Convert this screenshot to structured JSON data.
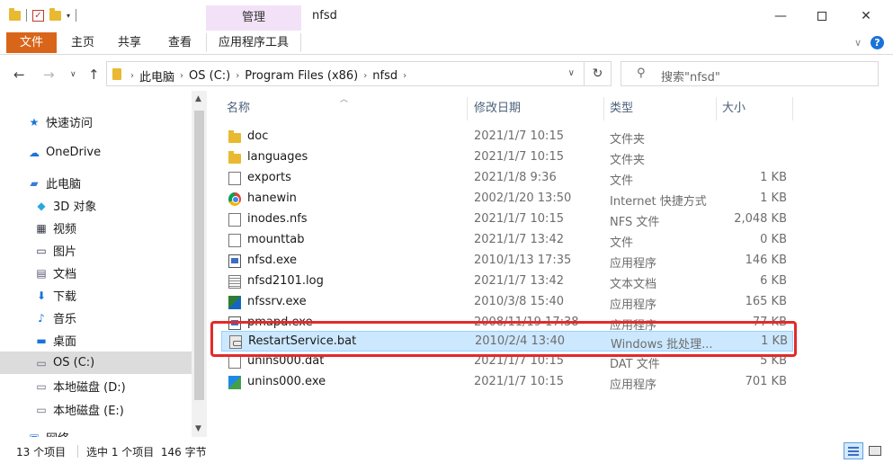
{
  "window": {
    "title": "nfsd",
    "manage_tab": "管理",
    "controls": {
      "minimize": "—",
      "close": "✕"
    }
  },
  "ribbon": {
    "tabs": [
      "文件",
      "主页",
      "共享",
      "查看"
    ],
    "app_tools": "应用程序工具",
    "help": "?"
  },
  "address": {
    "breadcrumbs": [
      "此电脑",
      "OS (C:)",
      "Program Files (x86)",
      "nfsd"
    ],
    "search_placeholder": "搜索\"nfsd\""
  },
  "nav": {
    "items": [
      {
        "label": "快速访问",
        "icon": "star-icon"
      },
      {
        "label": "OneDrive",
        "icon": "cloud-icon"
      },
      {
        "label": "此电脑",
        "icon": "pc-icon"
      },
      {
        "label": "3D 对象",
        "icon": "3d-objects-icon"
      },
      {
        "label": "视频",
        "icon": "video-icon"
      },
      {
        "label": "图片",
        "icon": "pictures-icon"
      },
      {
        "label": "文档",
        "icon": "documents-icon"
      },
      {
        "label": "下载",
        "icon": "download-icon"
      },
      {
        "label": "音乐",
        "icon": "music-icon"
      },
      {
        "label": "桌面",
        "icon": "desktop-icon"
      },
      {
        "label": "OS (C:)",
        "icon": "drive-icon"
      },
      {
        "label": "本地磁盘 (D:)",
        "icon": "drive-icon"
      },
      {
        "label": "本地磁盘 (E:)",
        "icon": "drive-icon"
      },
      {
        "label": "网络",
        "icon": "network-icon"
      }
    ]
  },
  "columns": {
    "name": "名称",
    "date": "修改日期",
    "type": "类型",
    "size": "大小"
  },
  "files": [
    {
      "name": "doc",
      "date": "2021/1/7 10:15",
      "type": "文件夹",
      "size": "",
      "icon": "folder-icon"
    },
    {
      "name": "languages",
      "date": "2021/1/7 10:15",
      "type": "文件夹",
      "size": "",
      "icon": "folder-icon"
    },
    {
      "name": "exports",
      "date": "2021/1/8 9:36",
      "type": "文件",
      "size": "1 KB",
      "icon": "file-icon"
    },
    {
      "name": "hanewin",
      "date": "2002/1/20 13:50",
      "type": "Internet 快捷方式",
      "size": "1 KB",
      "icon": "chrome-icon"
    },
    {
      "name": "inodes.nfs",
      "date": "2021/1/7 10:15",
      "type": "NFS 文件",
      "size": "2,048 KB",
      "icon": "file-icon"
    },
    {
      "name": "mounttab",
      "date": "2021/1/7 13:42",
      "type": "文件",
      "size": "0 KB",
      "icon": "file-icon"
    },
    {
      "name": "nfsd.exe",
      "date": "2010/1/13 17:35",
      "type": "应用程序",
      "size": "146 KB",
      "icon": "exe-icon"
    },
    {
      "name": "nfsd2101.log",
      "date": "2021/1/7 13:42",
      "type": "文本文档",
      "size": "6 KB",
      "icon": "text-file-icon"
    },
    {
      "name": "nfssrv.exe",
      "date": "2010/3/8 15:40",
      "type": "应用程序",
      "size": "165 KB",
      "icon": "nfssrv-icon"
    },
    {
      "name": "pmapd.exe",
      "date": "2008/11/19 17:38",
      "type": "应用程序",
      "size": "77 KB",
      "icon": "exe-icon"
    },
    {
      "name": "RestartService.bat",
      "date": "2010/2/4 13:40",
      "type": "Windows 批处理...",
      "size": "1 KB",
      "icon": "batch-file-icon"
    },
    {
      "name": "unins000.dat",
      "date": "2021/1/7 10:15",
      "type": "DAT 文件",
      "size": "5 KB",
      "icon": "file-icon"
    },
    {
      "name": "unins000.exe",
      "date": "2021/1/7 10:15",
      "type": "应用程序",
      "size": "701 KB",
      "icon": "uninstaller-icon"
    }
  ],
  "status": {
    "count": "13 个项目",
    "selection": "选中 1 个项目  146 字节"
  }
}
